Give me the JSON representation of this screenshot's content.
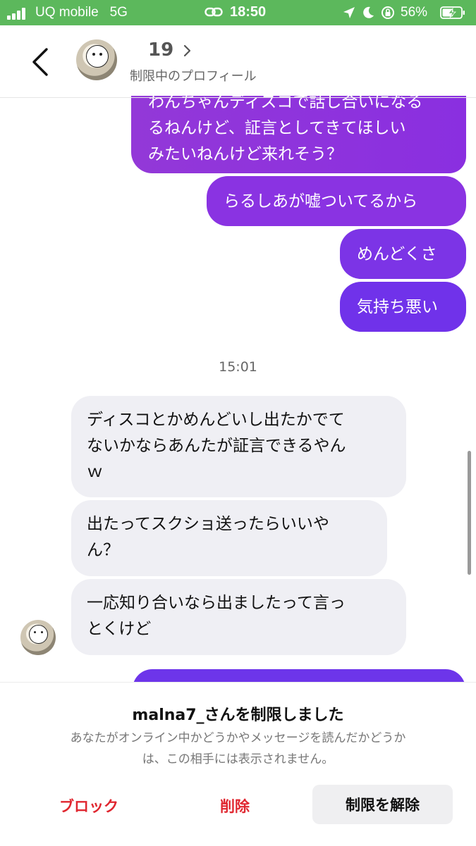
{
  "status_bar": {
    "carrier": "UQ mobile",
    "network": "5G",
    "time": "18:50",
    "battery": "56%",
    "background_color": "#5cb85c"
  },
  "header": {
    "name": "19",
    "subtitle": "制限中のプロフィール",
    "back_icon": "chevron-left-icon",
    "avatar_icon": "profile-avatar"
  },
  "messages": {
    "sent": [
      {
        "lines": [
          "わんちゃんディスコで話し合いになる",
          "るねんけど、証言としてきてほしい",
          "みたいねんけど来れそう？"
        ]
      },
      {
        "text": "らるしあが嘘ついてるから"
      },
      {
        "text": "めんどくさ"
      },
      {
        "text": "気持ち悪い"
      }
    ],
    "timestamp": "15:01",
    "received": [
      {
        "lines": [
          "ディスコとかめんどいし出たかでて",
          "ないかならあんたが証言できるやん",
          "ｗ"
        ]
      },
      {
        "lines": [
          "出たってスクショ送ったらいいや",
          "ん？"
        ]
      },
      {
        "lines": [
          "一応知り合いなら出ましたって言っ",
          "とくけど"
        ]
      }
    ]
  },
  "restriction_panel": {
    "title": "malna7_さんを制限しました",
    "description_lines": [
      "あなたがオンライン中かどうかやメッセージを読んだかどうか",
      "は、この相手には表示されません。"
    ],
    "block_label": "ブロック",
    "delete_label": "削除",
    "unrestrict_label": "制限を解除",
    "danger_color": "#e0262f"
  },
  "colors": {
    "sent_gradient_top": "#9338d8",
    "sent_gradient_bottom": "#6d35ea",
    "received_bg": "#efeff4"
  }
}
